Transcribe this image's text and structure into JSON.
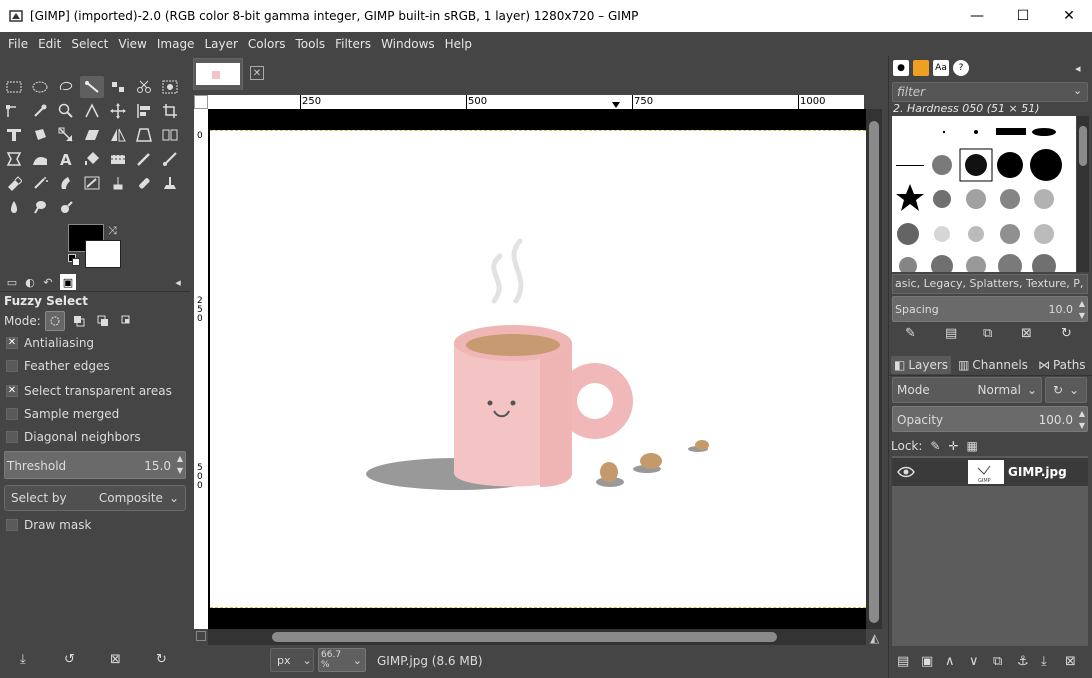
{
  "window": {
    "title": "[GIMP] (imported)-2.0 (RGB color 8-bit gamma integer, GIMP built-in sRGB, 1 layer) 1280x720 – GIMP",
    "minimize": "—",
    "maximize": "☐",
    "close": "✕"
  },
  "menu": [
    "File",
    "Edit",
    "Select",
    "View",
    "Image",
    "Layer",
    "Colors",
    "Tools",
    "Filters",
    "Windows",
    "Help"
  ],
  "tool_options": {
    "title": "Fuzzy Select",
    "mode_label": "Mode:",
    "checkboxes": [
      {
        "label": "Antialiasing",
        "checked": true
      },
      {
        "label": "Feather edges",
        "checked": false
      },
      {
        "label": "Select transparent areas",
        "checked": true
      },
      {
        "label": "Sample merged",
        "checked": false
      },
      {
        "label": "Diagonal neighbors",
        "checked": false
      }
    ],
    "threshold_label": "Threshold",
    "threshold_value": "15.0",
    "select_by_label": "Select by",
    "select_by_value": "Composite",
    "draw_mask_label": "Draw mask"
  },
  "ruler": {
    "h_ticks": [
      "250",
      "500",
      "750",
      "1000"
    ],
    "v_ticks": [
      "0",
      "250",
      "500"
    ]
  },
  "status": {
    "unit": "px",
    "zoom": "66.7 %",
    "text": "GIMP.jpg (8.6 MB)"
  },
  "brushes": {
    "filter_placeholder": "filter",
    "selected_brush": "2. Hardness 050 (51 × 51)",
    "tags": "asic, Legacy, Splatters, Texture, P, |",
    "spacing_label": "Spacing",
    "spacing_value": "10.0"
  },
  "layers": {
    "tabs": [
      "Layers",
      "Channels",
      "Paths"
    ],
    "mode_label": "Mode",
    "mode_value": "Normal",
    "opacity_label": "Opacity",
    "opacity_value": "100.0",
    "lock_label": "Lock:",
    "layer_name": "GIMP.jpg",
    "thumb_text": "GIMP"
  },
  "colors": {
    "foreground": "#000000",
    "background": "#ffffff",
    "mug": "#f4c4c4",
    "selection_marquee": "#d4c35a"
  }
}
